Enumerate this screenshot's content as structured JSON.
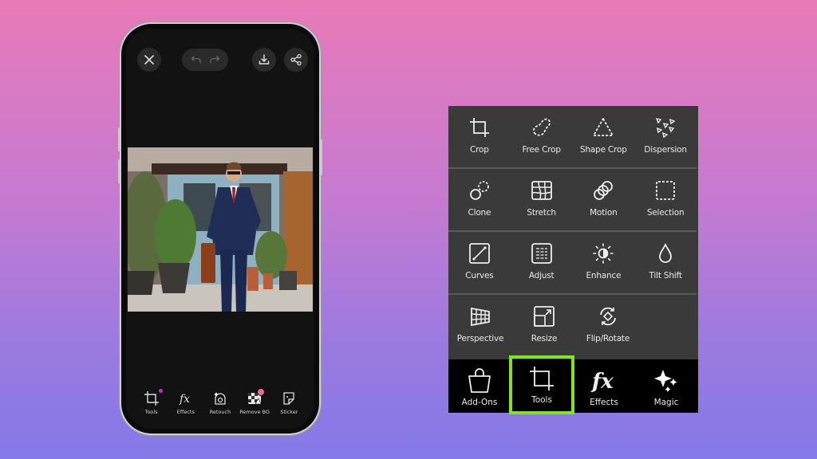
{
  "phone": {
    "top_bar": {
      "close_icon": "close-icon",
      "undo_icon": "undo-icon",
      "redo_icon": "redo-icon",
      "download_icon": "download-icon",
      "share_icon": "share-icon"
    },
    "photo": {
      "description": "Man in navy double-breasted suit with sunglasses and red striped tie, carrying a brown briefcase, in front of a storefront with plants"
    },
    "bottom_toolbar": [
      {
        "label": "Tools",
        "icon": "crop-icon",
        "has_dot": true
      },
      {
        "label": "Effects",
        "icon": "fx-icon"
      },
      {
        "label": "Retouch",
        "icon": "retouch-icon"
      },
      {
        "label": "Remove BG",
        "icon": "remove-bg-icon",
        "has_badge": true
      },
      {
        "label": "Sticker",
        "icon": "sticker-icon"
      }
    ]
  },
  "tools_panel": {
    "rows": [
      [
        {
          "label": "Crop",
          "icon": "crop-icon"
        },
        {
          "label": "Free Crop",
          "icon": "free-crop-icon"
        },
        {
          "label": "Shape Crop",
          "icon": "shape-crop-icon"
        },
        {
          "label": "Dispersion",
          "icon": "dispersion-icon"
        }
      ],
      [
        {
          "label": "Clone",
          "icon": "clone-icon"
        },
        {
          "label": "Stretch",
          "icon": "stretch-icon"
        },
        {
          "label": "Motion",
          "icon": "motion-icon"
        },
        {
          "label": "Selection",
          "icon": "selection-icon"
        }
      ],
      [
        {
          "label": "Curves",
          "icon": "curves-icon"
        },
        {
          "label": "Adjust",
          "icon": "adjust-icon"
        },
        {
          "label": "Enhance",
          "icon": "enhance-icon"
        },
        {
          "label": "Tilt Shift",
          "icon": "tilt-shift-icon"
        }
      ],
      [
        {
          "label": "Perspective",
          "icon": "perspective-icon"
        },
        {
          "label": "Resize",
          "icon": "resize-icon"
        },
        {
          "label": "Flip/Rotate",
          "icon": "flip-rotate-icon"
        }
      ]
    ],
    "nav": [
      {
        "label": "Add-Ons",
        "icon": "shopping-bag-icon"
      },
      {
        "label": "Tools",
        "icon": "crop-icon",
        "active": true
      },
      {
        "label": "Effects",
        "icon": "fx-icon"
      },
      {
        "label": "Magic",
        "icon": "sparkle-icon"
      }
    ],
    "highlight_color": "#7fe32a"
  },
  "colors": {
    "bg_top": "#e87ab8",
    "bg_bottom": "#8479e6",
    "panel_bg": "#3a3a3a",
    "nav_bg": "#000000",
    "notification_dot": "#c42fd1"
  }
}
